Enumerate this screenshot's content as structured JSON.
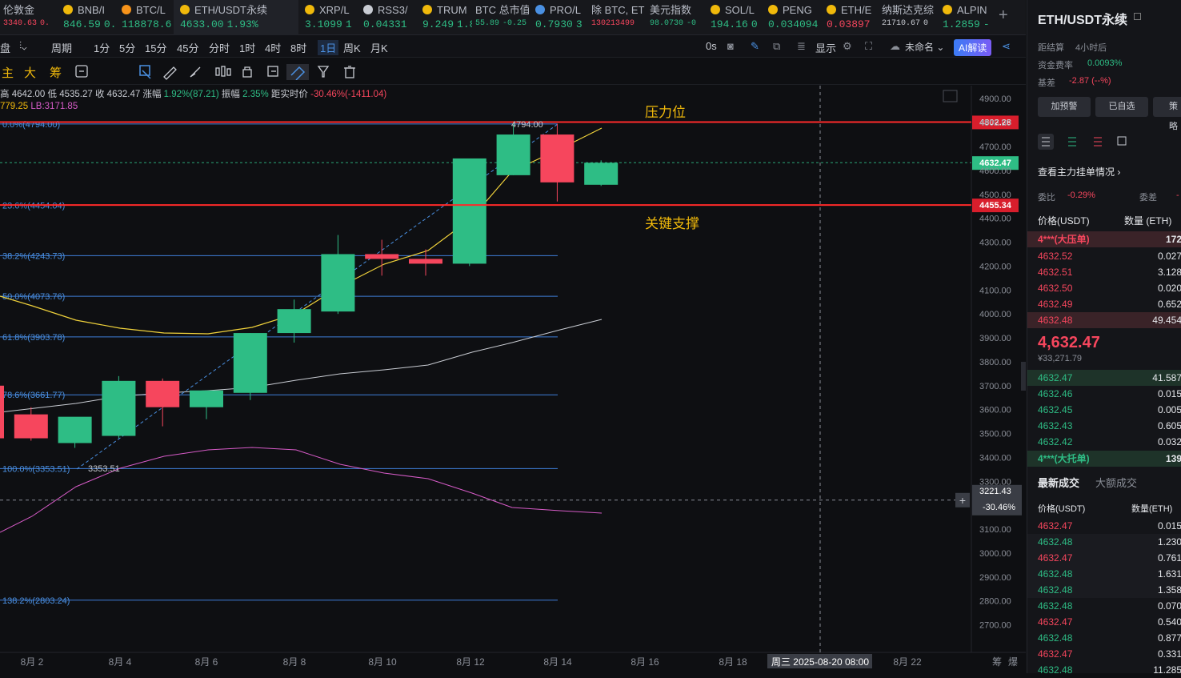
{
  "tabs": [
    {
      "name": "伦敦金",
      "price": "3340.63",
      "chg": "0.",
      "price_color": "#f6465d",
      "icon": "none"
    },
    {
      "name": "BNB/I",
      "price": "846.59",
      "chg": "0.",
      "price_color": "#2ebd85",
      "icon": "bnb-icon"
    },
    {
      "name": "BTC/L",
      "price": "118878.6",
      "chg": "",
      "price_color": "#2ebd85",
      "icon": "btc-icon"
    },
    {
      "name": "ETH/USDT永续",
      "price": "4633.00",
      "chg": "1.93%",
      "price_color": "#2ebd85",
      "icon": "eth-icon"
    },
    {
      "name": "XRP/L",
      "price": "3.1099",
      "chg": "1",
      "price_color": "#2ebd85",
      "icon": "xrp-icon"
    },
    {
      "name": "RSS3/",
      "price": "0.04331",
      "chg": "",
      "price_color": "#2ebd85",
      "icon": "rss3-icon"
    },
    {
      "name": "TRUM",
      "price": "9.249",
      "chg": "1.8",
      "price_color": "#2ebd85",
      "icon": "trump-icon"
    },
    {
      "name": "BTC 总市值",
      "price": "55.89",
      "chg": "-0.25",
      "price_color": "#2ebd85",
      "icon": "none"
    },
    {
      "name": "PRO/L",
      "price": "0.7930",
      "chg": "3",
      "price_color": "#2ebd85",
      "icon": "pro-icon"
    },
    {
      "name": "除 BTC, ET",
      "price": "130213499",
      "chg": "",
      "price_color": "#f6465d",
      "icon": "none"
    },
    {
      "name": "美元指数",
      "price": "98.0730",
      "chg": "-0",
      "price_color": "#2ebd85",
      "icon": "none"
    },
    {
      "name": "SOL/L",
      "price": "194.16",
      "chg": "0",
      "price_color": "#2ebd85",
      "icon": "sol-icon"
    },
    {
      "name": "PENG",
      "price": "0.034094",
      "chg": "",
      "price_color": "#2ebd85",
      "icon": "peng-icon"
    },
    {
      "name": "ETH/E",
      "price": "0.03897",
      "chg": "",
      "price_color": "#f6465d",
      "icon": "eth-icon"
    },
    {
      "name": "纳斯达克综",
      "price": "21710.67",
      "chg": "0",
      "price_color": "#c9ccd3",
      "icon": "none"
    },
    {
      "name": "ALPIN",
      "price": "1.2859",
      "chg": "-",
      "price_color": "#2ebd85",
      "icon": "alpine-icon"
    }
  ],
  "toolbar1": {
    "items": [
      "盘",
      "周期",
      "1分",
      "5分",
      "15分",
      "45分",
      "分时",
      "1时",
      "4时",
      "8时",
      "1日",
      "周K",
      "月K"
    ],
    "active": "1日",
    "right": [
      "0s",
      "显示",
      "未命名",
      "AI解读"
    ]
  },
  "toolbar2": {
    "items": [
      "主",
      "大",
      "筹"
    ]
  },
  "ohlc": {
    "high_label": "高",
    "high": "4642.00",
    "low_label": "低",
    "low": "4535.27",
    "close_label": "收",
    "close": "4632.47",
    "chg_label": "涨幅",
    "chg": "1.92%(87.21)",
    "amp_label": "振幅",
    "amp": "2.35%",
    "dist_label": "距实时价",
    "dist": "-30.46%(-1411.04)"
  },
  "ind_line": {
    "a": "779.25",
    "b": "LB:3171.85"
  },
  "annotations": {
    "resistance": "压力位",
    "support": "关键支撑",
    "high_mark": "4794.00",
    "low_mark": "3353.51"
  },
  "fib": [
    {
      "label": "0.0%(4794.00)",
      "price": 4794.0
    },
    {
      "label": "23.6%(4454.04)",
      "price": 4454.04
    },
    {
      "label": "38.2%(4243.73)",
      "price": 4243.73
    },
    {
      "label": "50.0%(4073.76)",
      "price": 4073.76
    },
    {
      "label": "61.8%(3903.78)",
      "price": 3903.78
    },
    {
      "label": "78.6%(3661.77)",
      "price": 3661.77
    },
    {
      "label": "100.0%(3353.51)",
      "price": 3353.51
    },
    {
      "label": "138.2%(2803.24)",
      "price": 2803.24
    }
  ],
  "hlines": [
    {
      "price": 4802.28,
      "label": "4802.28"
    },
    {
      "price": 4455.34,
      "label": "4455.34"
    }
  ],
  "current": {
    "price": 4632.47,
    "label": "4632.47"
  },
  "crosshair": {
    "price_label": "3221.43",
    "pct_label": "-30.46%",
    "date_label": "周三 2025-08-20 08:00"
  },
  "y_ticks": [
    "4900.00",
    "4800.00",
    "4700.00",
    "4600.00",
    "4500.00",
    "4400.00",
    "4300.00",
    "4200.00",
    "4100.00",
    "4000.00",
    "3900.00",
    "3800.00",
    "3700.00",
    "3600.00",
    "3500.00",
    "3400.00",
    "3300.00",
    "3100.00",
    "3000.00",
    "2900.00",
    "2800.00",
    "2700.00"
  ],
  "x_ticks": [
    "8月 2",
    "8月 4",
    "8月 6",
    "8月 8",
    "8月 10",
    "8月 12",
    "8月 14",
    "8月 16",
    "8月 18",
    "8月 22"
  ],
  "chart_data": {
    "type": "candlestick",
    "x": [
      "8月1",
      "8月2",
      "8月3",
      "8月4",
      "8月5",
      "8月6",
      "8月7",
      "8月8",
      "8月9",
      "8月10",
      "8月11",
      "8月12",
      "8月13",
      "8月14",
      "8月15"
    ],
    "ohlc": [
      [
        3700,
        3710,
        3460,
        3480
      ],
      [
        3580,
        3610,
        3470,
        3480
      ],
      [
        3460,
        3560,
        3440,
        3570
      ],
      [
        3490,
        3740,
        3480,
        3720
      ],
      [
        3720,
        3730,
        3530,
        3610
      ],
      [
        3610,
        3680,
        3560,
        3680
      ],
      [
        3670,
        3920,
        3640,
        3920
      ],
      [
        3920,
        4060,
        3880,
        4020
      ],
      [
        4010,
        4330,
        4000,
        4250
      ],
      [
        4250,
        4310,
        4160,
        4230
      ],
      [
        4230,
        4270,
        4160,
        4210
      ],
      [
        4210,
        4640,
        4200,
        4650
      ],
      [
        4580,
        4800,
        4580,
        4750
      ],
      [
        4750,
        4794,
        4470,
        4550
      ],
      [
        4540,
        4642,
        4535,
        4632
      ]
    ],
    "ylim": [
      2650,
      4950
    ]
  },
  "right": {
    "title": "ETH/USDT永续",
    "settle_label": "距结算",
    "settle": "4小时后",
    "fund_label": "资金费率",
    "fund": "0.0093%",
    "basis_label": "基差",
    "basis": "-2.87 (--%)",
    "buttons": [
      "加预警",
      "已自选",
      "策略"
    ],
    "depth_link": "查看主力挂单情况",
    "wb_label": "委比",
    "wb": "-0.29%",
    "wc_label": "委差",
    "wc": "-",
    "col_price": "价格(USDT)",
    "col_qty": "数量 (ETH)",
    "ask_big": {
      "p": "4***(大压单)",
      "q": "172"
    },
    "asks": [
      [
        "4632.52",
        "0.027"
      ],
      [
        "4632.51",
        "3.128"
      ],
      [
        "4632.50",
        "0.020"
      ],
      [
        "4632.49",
        "0.652"
      ],
      [
        "4632.48",
        "49.454"
      ]
    ],
    "last": "4,632.47",
    "last_cny": "¥33,271.79",
    "bids": [
      [
        "4632.47",
        "41.587"
      ],
      [
        "4632.46",
        "0.015"
      ],
      [
        "4632.45",
        "0.005"
      ],
      [
        "4632.43",
        "0.605"
      ],
      [
        "4632.42",
        "0.032"
      ]
    ],
    "bid_big": {
      "p": "4***(大托单)",
      "q": "139"
    },
    "trades_tab1": "最新成交",
    "trades_tab2": "大额成交",
    "t_col_price": "价格(USDT)",
    "t_col_qty": "数量(ETH)",
    "trades": [
      [
        "4632.47",
        "0.015",
        "#f6465d"
      ],
      [
        "4632.48",
        "1.230",
        "#2ebd85"
      ],
      [
        "4632.47",
        "0.761",
        "#f6465d"
      ],
      [
        "4632.48",
        "1.631",
        "#2ebd85"
      ],
      [
        "4632.48",
        "1.358",
        "#2ebd85"
      ],
      [
        "4632.48",
        "0.070",
        "#2ebd85"
      ],
      [
        "4632.47",
        "0.540",
        "#f6465d"
      ],
      [
        "4632.48",
        "0.877",
        "#2ebd85"
      ],
      [
        "4632.47",
        "0.331",
        "#f6465d"
      ],
      [
        "4632.48",
        "11.285",
        "#2ebd85"
      ]
    ]
  },
  "footer": {
    "a": "筹",
    "b": "爆"
  }
}
